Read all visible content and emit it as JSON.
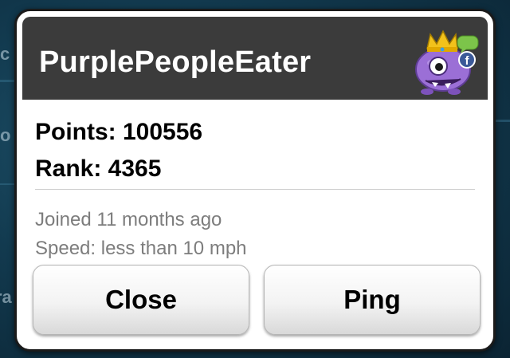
{
  "profile": {
    "username": "PurplePeopleEater",
    "points_line": "Points: 100556",
    "rank_line": "Rank: 4365",
    "joined": "Joined 11 months ago",
    "speed": "Speed: less than 10 mph"
  },
  "buttons": {
    "close_label": "Close",
    "ping_label": "Ping"
  },
  "background_edge_text": [
    "c",
    "o",
    "ra"
  ],
  "icons": {
    "avatar": "purple-monster-avatar",
    "crown": "crown-icon",
    "chat": "chat-bubble-icon",
    "facebook": "facebook-icon"
  },
  "colors": {
    "header_bg": "#3b3b3b",
    "title_text": "#ffffff",
    "avatar_purple": "#9b6fd6",
    "crown_gold": "#f2c21b",
    "facebook_blue": "#3b5998",
    "chat_green": "#7cc44a",
    "info_text": "#7d7d7d"
  }
}
